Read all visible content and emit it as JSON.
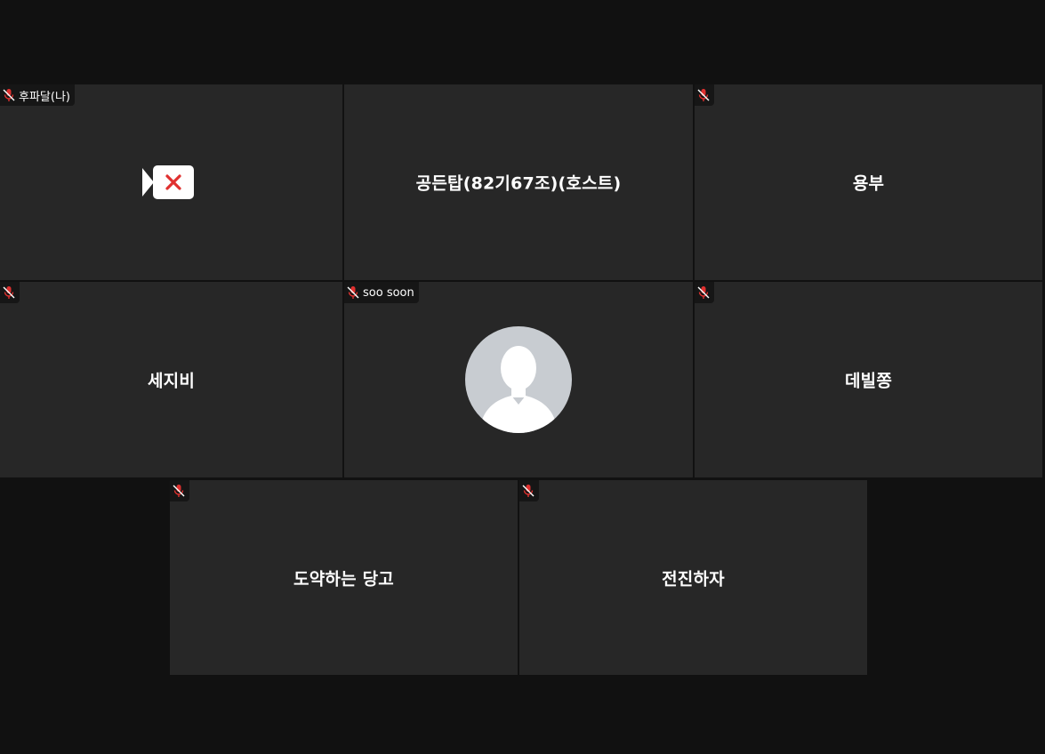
{
  "participants": [
    {
      "name": "후파달(나)",
      "tag_label": "후파달(나)",
      "center_name": "",
      "muted": true,
      "video_off_icon": "camera-off-icon"
    },
    {
      "name": "공든탑(82기67조)(호스트)",
      "tag_label": "",
      "center_name": "공든탑(82기67조)(호스트)",
      "muted": false
    },
    {
      "name": "용부",
      "tag_label": "",
      "center_name": "용부",
      "muted": true
    },
    {
      "name": "세지비",
      "tag_label": "",
      "center_name": "세지비",
      "muted": true
    },
    {
      "name": "soo soon",
      "tag_label": "soo soon",
      "center_name": "",
      "muted": true,
      "avatar_icon": "default-avatar-icon"
    },
    {
      "name": "데빌쫑",
      "tag_label": "",
      "center_name": "데빌쫑",
      "muted": true
    },
    {
      "name": "도약하는 당고",
      "tag_label": "",
      "center_name": "도약하는 당고",
      "muted": true
    },
    {
      "name": "전진하자",
      "tag_label": "",
      "center_name": "전진하자",
      "muted": true
    }
  ],
  "colors": {
    "background": "#111111",
    "tile": "#272727",
    "tag_background": "#161616",
    "muted_mic": "#e0302f",
    "camera_off_x": "#e0302f",
    "avatar": "#c8ccd1"
  }
}
